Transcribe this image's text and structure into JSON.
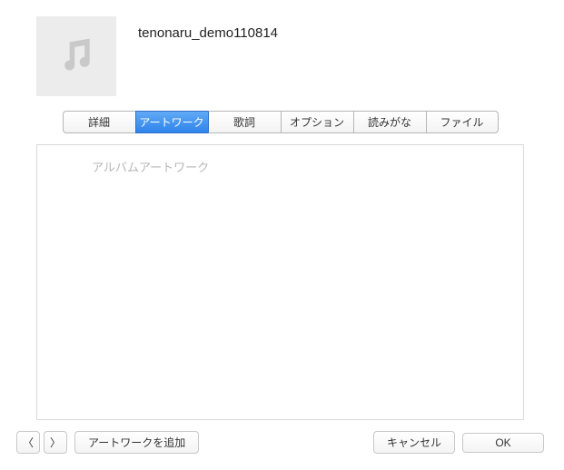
{
  "header": {
    "title": "tenonaru_demo110814"
  },
  "tabs": [
    {
      "label": "詳細",
      "active": false
    },
    {
      "label": "アートワーク",
      "active": true
    },
    {
      "label": "歌詞",
      "active": false
    },
    {
      "label": "オプション",
      "active": false
    },
    {
      "label": "読みがな",
      "active": false
    },
    {
      "label": "ファイル",
      "active": false
    }
  ],
  "content": {
    "section_label": "アルバムアートワーク"
  },
  "footer": {
    "prev": "〈",
    "next": "〉",
    "add_artwork": "アートワークを追加",
    "cancel": "キャンセル",
    "ok": "OK"
  }
}
